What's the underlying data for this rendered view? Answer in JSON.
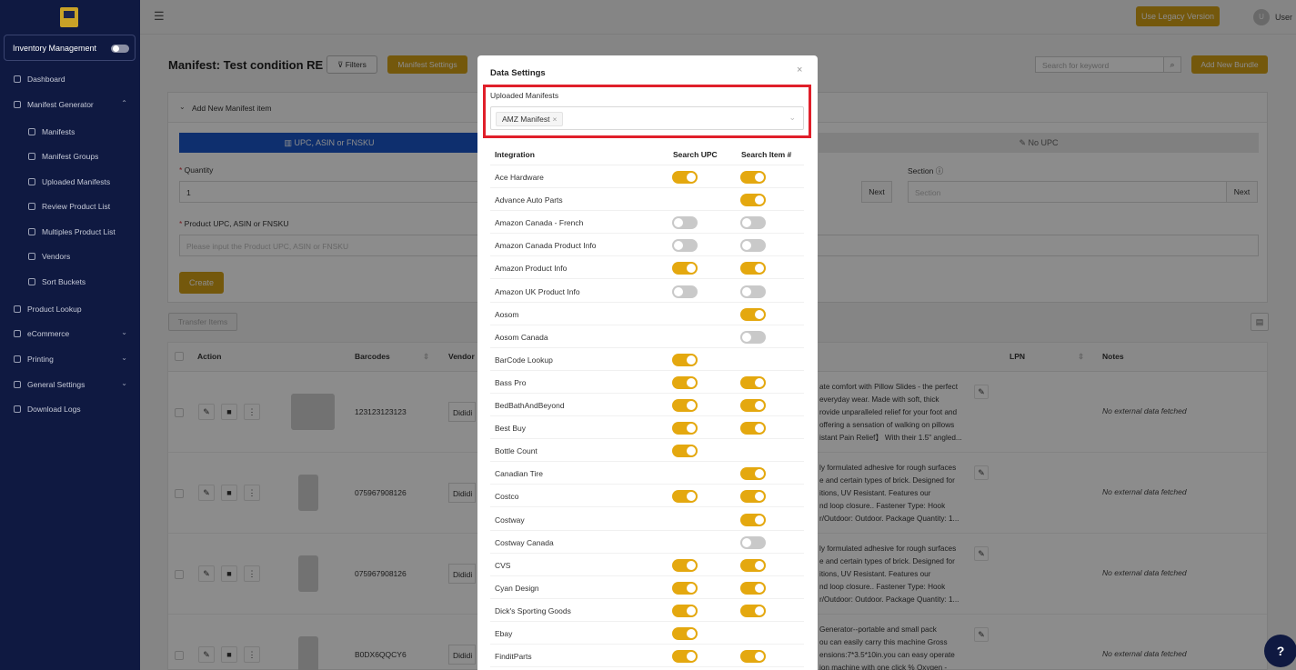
{
  "sidebar": {
    "inventory_label": "Inventory Management",
    "items": [
      {
        "label": "Dashboard",
        "icon": "dashboard-icon",
        "sub": false,
        "chev": ""
      },
      {
        "label": "Manifest Generator",
        "icon": "sitemap-icon",
        "sub": false,
        "chev": "^"
      },
      {
        "label": "Manifests",
        "icon": "manifest-icon",
        "sub": true,
        "chev": ""
      },
      {
        "label": "Manifest Groups",
        "icon": "groups-icon",
        "sub": true,
        "chev": ""
      },
      {
        "label": "Uploaded Manifests",
        "icon": "file-icon",
        "sub": true,
        "chev": ""
      },
      {
        "label": "Review Product List",
        "icon": "percent-icon",
        "sub": true,
        "chev": ""
      },
      {
        "label": "Multiples Product List",
        "icon": "file-icon",
        "sub": true,
        "chev": ""
      },
      {
        "label": "Vendors",
        "icon": "cart-icon",
        "sub": true,
        "chev": ""
      },
      {
        "label": "Sort Buckets",
        "icon": "bucket-icon",
        "sub": true,
        "chev": ""
      },
      {
        "label": "Product Lookup",
        "icon": "file-icon",
        "sub": false,
        "chev": ""
      },
      {
        "label": "eCommerce",
        "icon": "shop-icon",
        "sub": false,
        "chev": "v"
      },
      {
        "label": "Printing",
        "icon": "print-icon",
        "sub": false,
        "chev": "v"
      },
      {
        "label": "General Settings",
        "icon": "settings-icon",
        "sub": false,
        "chev": "v"
      },
      {
        "label": "Download Logs",
        "icon": "file-icon",
        "sub": false,
        "chev": ""
      }
    ]
  },
  "topbar": {
    "menu_icon": "☰",
    "legacy_label": "Use Legacy Version",
    "avatar_letter": "U",
    "user_label": "User"
  },
  "header": {
    "title": "Manifest: Test condition RE",
    "filters_label": "Filters",
    "manifest_settings_label": "Manifest Settings",
    "search_placeholder": "Search for keyword",
    "add_bundle_label": "Add New Bundle"
  },
  "add_panel": {
    "title": "Add New Manifest item",
    "tab_upc": "UPC, ASIN or FNSKU",
    "tab_noupc": "No UPC",
    "quantity_label": "Quantity",
    "quantity_value": "1",
    "section_label": "Section",
    "section_placeholder": "Section",
    "next_label": "Next",
    "product_label": "Product UPC, ASIN or FNSKU",
    "product_placeholder": "Please input the Product UPC, ASIN or FNSKU",
    "create_label": "Create"
  },
  "table": {
    "transfer_label": "Transfer Items",
    "headers": {
      "action": "Action",
      "barcodes": "Barcodes",
      "vendor": "Vendor",
      "lpn": "LPN",
      "notes": "Notes"
    },
    "rows": [
      {
        "barcode": "123123123123",
        "vendor": "Dididi",
        "desc": [
          "ate comfort with Pillow Slides - the perfect",
          "everyday wear. Made with soft, thick",
          "rovide unparalleled relief for your foot and",
          "offering a sensation of walking on pillows",
          "istant Pain Relief】 With their 1.5\" angled..."
        ],
        "notes": "No external data fetched"
      },
      {
        "barcode": "075967908126",
        "vendor": "Dididi",
        "desc": [
          "ly formulated adhesive for rough surfaces",
          "e and certain types of brick. Designed for",
          "itions, UV Resistant. Features our",
          "nd loop closure.. Fastener Type: Hook",
          "r/Outdoor: Outdoor. Package Quantity: 1..."
        ],
        "notes": "No external data fetched"
      },
      {
        "barcode": "075967908126",
        "vendor": "Dididi",
        "desc": [
          "ly formulated adhesive for rough surfaces",
          "e and certain types of brick. Designed for",
          "itions, UV Resistant. Features our",
          "nd loop closure.. Fastener Type: Hook",
          "r/Outdoor: Outdoor. Package Quantity: 1..."
        ],
        "notes": "No external data fetched"
      },
      {
        "barcode": "B0DX6QQCY6",
        "vendor": "Dididi",
        "desc": [
          "Generator--portable and small pack",
          "ou can easily carry this machine Gross",
          "ensions:7*3.5*10in.you can easy operate",
          "ion machine with one click % Oxygen -",
          ""
        ],
        "notes": "No external data fetched"
      }
    ]
  },
  "modal": {
    "title": "Data Settings",
    "close": "×",
    "uploaded_label": "Uploaded Manifests",
    "selected_tag": "AMZ Manifest",
    "tag_remove": "×",
    "col_integration": "Integration",
    "col_upc": "Search UPC",
    "col_item": "Search Item #",
    "integrations": [
      {
        "name": "Ace Hardware",
        "upc": true,
        "item": true
      },
      {
        "name": "Advance Auto Parts",
        "upc": null,
        "item": true
      },
      {
        "name": "Amazon Canada - French",
        "upc": false,
        "item": false
      },
      {
        "name": "Amazon Canada Product Info",
        "upc": false,
        "item": false
      },
      {
        "name": "Amazon Product Info",
        "upc": true,
        "item": true
      },
      {
        "name": "Amazon UK Product Info",
        "upc": false,
        "item": false
      },
      {
        "name": "Aosom",
        "upc": null,
        "item": true
      },
      {
        "name": "Aosom Canada",
        "upc": null,
        "item": false
      },
      {
        "name": "BarCode Lookup",
        "upc": true,
        "item": null
      },
      {
        "name": "Bass Pro",
        "upc": true,
        "item": true
      },
      {
        "name": "BedBathAndBeyond",
        "upc": true,
        "item": true
      },
      {
        "name": "Best Buy",
        "upc": true,
        "item": true
      },
      {
        "name": "Bottle Count",
        "upc": true,
        "item": null
      },
      {
        "name": "Canadian Tire",
        "upc": null,
        "item": true
      },
      {
        "name": "Costco",
        "upc": true,
        "item": true
      },
      {
        "name": "Costway",
        "upc": null,
        "item": true
      },
      {
        "name": "Costway Canada",
        "upc": null,
        "item": false
      },
      {
        "name": "CVS",
        "upc": true,
        "item": true
      },
      {
        "name": "Cyan Design",
        "upc": true,
        "item": true
      },
      {
        "name": "Dick's Sporting Goods",
        "upc": true,
        "item": true
      },
      {
        "name": "Ebay",
        "upc": true,
        "item": null
      },
      {
        "name": "FinditParts",
        "upc": true,
        "item": true
      }
    ]
  },
  "help_label": "?"
}
